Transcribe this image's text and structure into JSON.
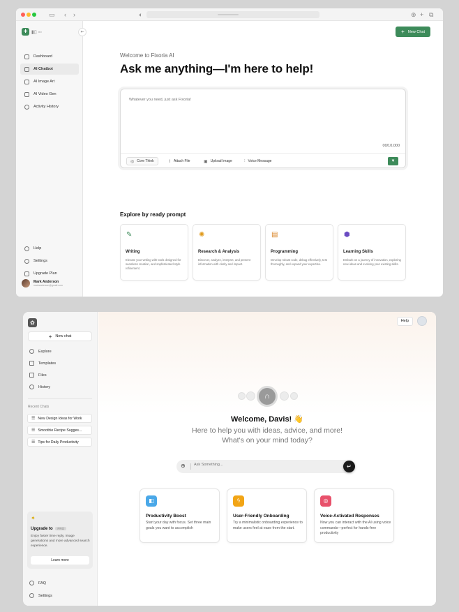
{
  "top": {
    "nav": [
      {
        "label": "Dashboard",
        "icon": "home-icon"
      },
      {
        "label": "AI Chatbot",
        "icon": "chat-icon",
        "active": true
      },
      {
        "label": "AI Image Art",
        "icon": "image-icon"
      },
      {
        "label": "AI Video Gen",
        "icon": "video-icon"
      },
      {
        "label": "Activity History",
        "icon": "history-icon"
      }
    ],
    "bottom_nav": [
      {
        "label": "Help",
        "icon": "help-icon"
      },
      {
        "label": "Settings",
        "icon": "gear-icon"
      },
      {
        "label": "Upgrade Plan",
        "icon": "crown-icon"
      }
    ],
    "user": {
      "name": "Mark Anderson",
      "email": "markanderson@gmail.com"
    },
    "new_chat": "New Chat",
    "welcome": "Welcome to Fixoria AI",
    "headline": "Ask me anything—I'm here to help!",
    "prompt_placeholder": "Whatever you need, just ask Fixoria!",
    "counter": "00/10,000",
    "tools": [
      "Core Think",
      "Attach File",
      "Upload Image",
      "Voice Message"
    ],
    "explore_title": "Explore by ready prompt",
    "cards": [
      {
        "title": "Writing",
        "desc": "Elevate your writing with tools designed for seamless creation, and sophisticated style refinement.",
        "color": "#3d8b5a"
      },
      {
        "title": "Research & Analysis",
        "desc": "Discover, analyze, interpret, and present information with clarity and impact.",
        "color": "#e09a1c"
      },
      {
        "title": "Programming",
        "desc": "Develop robust code, debug effectively, test thoroughly, and expand your expertise.",
        "color": "#d98324"
      },
      {
        "title": "Learning Skills",
        "desc": "Embark on a journey of innovation, exploring new ideas and evolving your existing skills.",
        "color": "#6a4bc2"
      }
    ]
  },
  "bottom": {
    "new_chat": "New chat",
    "nav": [
      "Explore",
      "Templates",
      "Files",
      "History"
    ],
    "recent_title": "Recent Chats",
    "recent": [
      "New Design Ideas for Work",
      "Smoothie Recipe Sugges...",
      "Tips for Daily Productivity"
    ],
    "upgrade": {
      "title": "Upgrade to",
      "badge": "PRO",
      "desc": "Enjoy faster time reply, image generations and more advanced search experience.",
      "button": "Learn more"
    },
    "bottom_nav": [
      "FAQ",
      "Settings"
    ],
    "help": "Help",
    "welcome": "Welcome, Davis! 👋",
    "subtitle": "Here to help you with ideas, advice, and more! What's on your mind today?",
    "ask_placeholder": "Ask Something...",
    "cards": [
      {
        "title": "Productivity Boost",
        "desc": "Start your day with focus. Set three main goals you want to accomplish",
        "color": "#4aa8e8"
      },
      {
        "title": "User-Friendly Onboarding",
        "desc": "Try a minimalistic onboarding experience to make users feel at ease from the start.",
        "color": "#f2a516"
      },
      {
        "title": "Voice-Activated Responses",
        "desc": "Now you can interact with the AI using voice commands—perfect for hands-free productivity",
        "color": "#e8516b"
      }
    ]
  }
}
